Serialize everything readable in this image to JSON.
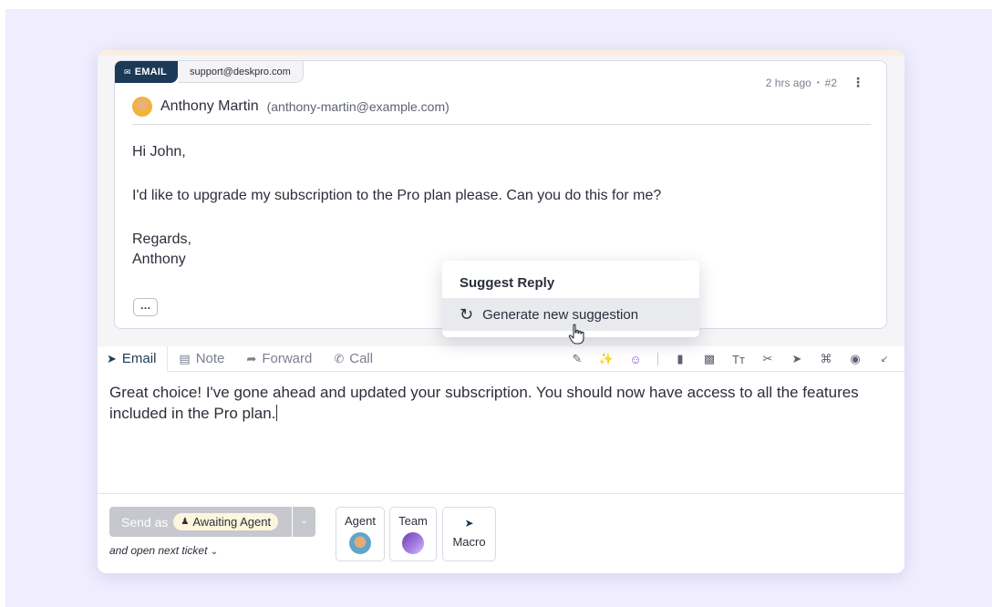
{
  "message": {
    "channel_label": "EMAIL",
    "inbox_address": "support@deskpro.com",
    "time_ago": "2 hrs ago",
    "separator": "•",
    "message_number": "#2",
    "sender_name": "Anthony Martin",
    "sender_email": "(anthony-martin@example.com)",
    "body": {
      "greeting": "Hi John,",
      "line1": "I'd like to upgrade my subscription to the Pro plan please. Can you do this for me?",
      "signoff": "Regards,",
      "signature": "Anthony"
    },
    "more_label": "…"
  },
  "suggest_popup": {
    "title": "Suggest Reply",
    "action": "Generate new suggestion"
  },
  "tabs": [
    {
      "label": "Email",
      "icon": "send-icon"
    },
    {
      "label": "Note",
      "icon": "note-icon"
    },
    {
      "label": "Forward",
      "icon": "forward-icon"
    },
    {
      "label": "Call",
      "icon": "phone-icon"
    }
  ],
  "composer": {
    "text": "Great choice! I've gone ahead and updated your subscription. You should now have access to all the features included in the Pro plan."
  },
  "footer": {
    "send_as": "Send as",
    "status": "Awaiting Agent",
    "next_ticket": "and open next ticket",
    "agent_label": "Agent",
    "team_label": "Team",
    "macro_label": "Macro"
  },
  "colors": {
    "accent": "#1c3a57",
    "ai_purple": "#8a52e0",
    "background": "#efedfe"
  }
}
